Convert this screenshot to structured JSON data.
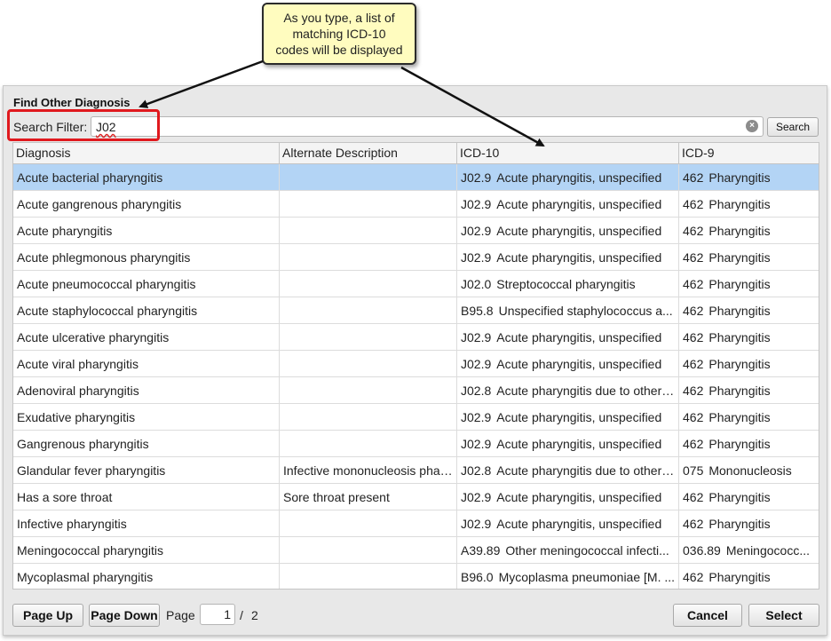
{
  "callout": {
    "line1": "As you type, a list of",
    "line2": "matching ICD-10",
    "line3": "codes will be displayed"
  },
  "dialog": {
    "title": "Find Other Diagnosis",
    "filter_label": "Search Filter:",
    "filter_value": "J02",
    "search_button": "Search"
  },
  "columns": [
    "Diagnosis",
    "Alternate Description",
    "ICD-10",
    "ICD-9"
  ],
  "rows": [
    {
      "diagnosis": "Acute bacterial pharyngitis",
      "alt": "",
      "icd10_code": "J02.9",
      "icd10_desc": "Acute pharyngitis, unspecified",
      "icd9_code": "462",
      "icd9_desc": "Pharyngitis"
    },
    {
      "diagnosis": "Acute gangrenous pharyngitis",
      "alt": "",
      "icd10_code": "J02.9",
      "icd10_desc": "Acute pharyngitis, unspecified",
      "icd9_code": "462",
      "icd9_desc": "Pharyngitis"
    },
    {
      "diagnosis": "Acute pharyngitis",
      "alt": "",
      "icd10_code": "J02.9",
      "icd10_desc": "Acute pharyngitis, unspecified",
      "icd9_code": "462",
      "icd9_desc": "Pharyngitis"
    },
    {
      "diagnosis": "Acute phlegmonous pharyngitis",
      "alt": "",
      "icd10_code": "J02.9",
      "icd10_desc": "Acute pharyngitis, unspecified",
      "icd9_code": "462",
      "icd9_desc": "Pharyngitis"
    },
    {
      "diagnosis": "Acute pneumococcal pharyngitis",
      "alt": "",
      "icd10_code": "J02.0",
      "icd10_desc": "Streptococcal pharyngitis",
      "icd9_code": "462",
      "icd9_desc": "Pharyngitis"
    },
    {
      "diagnosis": "Acute staphylococcal pharyngitis",
      "alt": "",
      "icd10_code": "B95.8",
      "icd10_desc": "Unspecified staphylococcus a...",
      "icd9_code": "462",
      "icd9_desc": "Pharyngitis"
    },
    {
      "diagnosis": "Acute ulcerative pharyngitis",
      "alt": "",
      "icd10_code": "J02.9",
      "icd10_desc": "Acute pharyngitis, unspecified",
      "icd9_code": "462",
      "icd9_desc": "Pharyngitis"
    },
    {
      "diagnosis": "Acute viral pharyngitis",
      "alt": "",
      "icd10_code": "J02.9",
      "icd10_desc": "Acute pharyngitis, unspecified",
      "icd9_code": "462",
      "icd9_desc": "Pharyngitis"
    },
    {
      "diagnosis": "Adenoviral pharyngitis",
      "alt": "",
      "icd10_code": "J02.8",
      "icd10_desc": "Acute pharyngitis due to other ...",
      "icd9_code": "462",
      "icd9_desc": "Pharyngitis"
    },
    {
      "diagnosis": "Exudative pharyngitis",
      "alt": "",
      "icd10_code": "J02.9",
      "icd10_desc": "Acute pharyngitis, unspecified",
      "icd9_code": "462",
      "icd9_desc": "Pharyngitis"
    },
    {
      "diagnosis": "Gangrenous pharyngitis",
      "alt": "",
      "icd10_code": "J02.9",
      "icd10_desc": "Acute pharyngitis, unspecified",
      "icd9_code": "462",
      "icd9_desc": "Pharyngitis"
    },
    {
      "diagnosis": "Glandular fever pharyngitis",
      "alt": "Infective mononucleosis phar...",
      "icd10_code": "J02.8",
      "icd10_desc": "Acute pharyngitis due to other ...",
      "icd9_code": "075",
      "icd9_desc": "Mononucleosis"
    },
    {
      "diagnosis": "Has a sore throat",
      "alt": "Sore throat present",
      "icd10_code": "J02.9",
      "icd10_desc": "Acute pharyngitis, unspecified",
      "icd9_code": "462",
      "icd9_desc": "Pharyngitis"
    },
    {
      "diagnosis": "Infective pharyngitis",
      "alt": "",
      "icd10_code": "J02.9",
      "icd10_desc": "Acute pharyngitis, unspecified",
      "icd9_code": "462",
      "icd9_desc": "Pharyngitis"
    },
    {
      "diagnosis": "Meningococcal pharyngitis",
      "alt": "",
      "icd10_code": "A39.89",
      "icd10_desc": "Other meningococcal infecti...",
      "icd9_code": "036.89",
      "icd9_desc": "Meningococc..."
    },
    {
      "diagnosis": "Mycoplasmal pharyngitis",
      "alt": "",
      "icd10_code": "B96.0",
      "icd10_desc": "Mycoplasma pneumoniae [M. ...",
      "icd9_code": "462",
      "icd9_desc": "Pharyngitis"
    }
  ],
  "selected_row": 0,
  "footer": {
    "page_up": "Page Up",
    "page_down": "Page Down",
    "page_label": "Page",
    "page_current": "1",
    "page_sep": "/",
    "page_total": "2",
    "cancel": "Cancel",
    "select": "Select"
  },
  "colors": {
    "selection": "#b3d4f5",
    "highlight": "#e0191e",
    "callout_bg": "#fffcbf"
  }
}
